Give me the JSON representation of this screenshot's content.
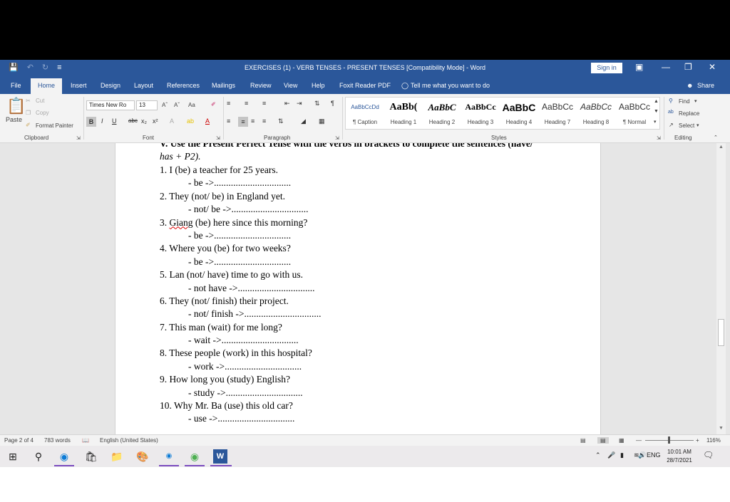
{
  "window": {
    "title": "EXERCISES (1) - VERB TENSES - PRESENT TENSES [Compatibility Mode] - Word",
    "sign_in": "Sign in"
  },
  "tabs": [
    "File",
    "Home",
    "Insert",
    "Design",
    "Layout",
    "References",
    "Mailings",
    "Review",
    "View",
    "Help",
    "Foxit Reader PDF"
  ],
  "tell_me": "Tell me what you want to do",
  "share": "Share",
  "clipboard": {
    "paste": "Paste",
    "cut": "Cut",
    "copy": "Copy",
    "format_painter": "Format Painter",
    "label": "Clipboard"
  },
  "font": {
    "name": "Times New Ro",
    "size": "13",
    "label": "Font",
    "change_case": "Aa"
  },
  "paragraph": {
    "label": "Paragraph"
  },
  "styles": {
    "label": "Styles",
    "items": [
      {
        "sample": "AaBbCcDd",
        "name": "¶ Caption"
      },
      {
        "sample": "AaBb(",
        "name": "Heading 1"
      },
      {
        "sample": "AaBbC",
        "name": "Heading 2"
      },
      {
        "sample": "AaBbCc",
        "name": "Heading 3"
      },
      {
        "sample": "AaBbC",
        "name": "Heading 4"
      },
      {
        "sample": "AaBbCc",
        "name": "Heading 7"
      },
      {
        "sample": "AaBbCc",
        "name": "Heading 8"
      },
      {
        "sample": "AaBbCc",
        "name": "¶ Normal"
      }
    ]
  },
  "editing": {
    "find": "Find",
    "replace": "Replace",
    "select": "Select",
    "label": "Editing"
  },
  "document": {
    "heading_line1": "V. Use the Present Perfect Tense with the verbs in brackets to complete the sentences (have/",
    "heading_line2": "has + P2).",
    "items": [
      {
        "q": "1. I (be) a teacher for 25 years.",
        "a": "- be ->................................"
      },
      {
        "q_pre": "3. ",
        "q_squiggle": "Giang",
        "q_post": " (be) here since this morning?",
        "a": "- be ->................................"
      },
      {
        "q": "2. They (not/ be) in England yet.",
        "a": "- not/ be ->................................"
      },
      {
        "q": "4. Where you (be) for two weeks?",
        "a": "- be ->................................"
      },
      {
        "q": "5. Lan (not/ have) time to go with us.",
        "a": "- not have ->................................"
      },
      {
        "q": "6. They (not/ finish) their project.",
        "a": "- not/ finish ->................................"
      },
      {
        "q": "7. This man (wait) for me long?",
        "a": "- wait ->................................"
      },
      {
        "q": "8. These people (work) in this hospital?",
        "a": "- work ->................................"
      },
      {
        "q": "9. How long you (study) English?",
        "a": "- study ->................................"
      },
      {
        "q": "10. Why Mr. Ba (use) this old car?",
        "a": "- use ->................................"
      }
    ]
  },
  "status": {
    "page": "Page 2 of 4",
    "words": "783 words",
    "language": "English (United States)",
    "zoom": "116%"
  },
  "taskbar": {
    "language": "ENG",
    "time": "10:01 AM",
    "date": "28/7/2021"
  }
}
